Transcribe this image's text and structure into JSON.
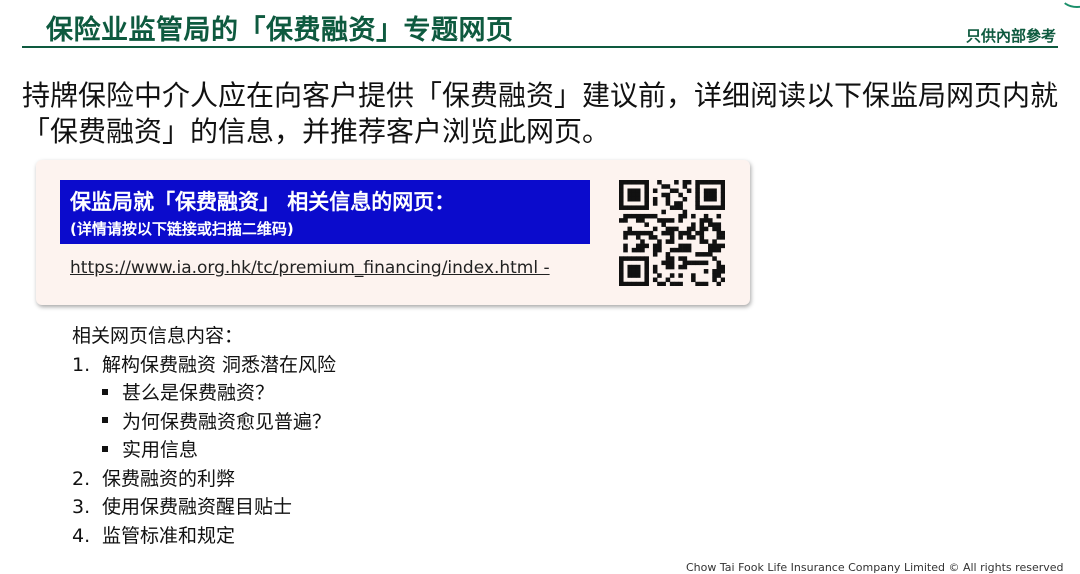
{
  "header": {
    "title": "保险业监管局的「保费融资」专题网页",
    "internal_note": "只供內部參考"
  },
  "intro": {
    "text": "持牌保险中介人应在向客户提供「保费融资」建议前，详细阅读以下保监局网页内就「保费融资」的信息，并推荐客户浏览此网页。"
  },
  "info_box": {
    "banner_title": "保监局就「保费融资」 相关信息的网页：",
    "banner_subtitle": "(详情请按以下链接或扫描二维码)",
    "url": "https://www.ia.org.hk/tc/premium_financing/index.html -"
  },
  "contents": {
    "heading": "相关网页信息内容：",
    "items": [
      {
        "number": "1.",
        "label": "解构保费融资 洞悉潜在风险",
        "sub_items": [
          "甚么是保费融资？",
          "为何保费融资愈见普遍？",
          "实用信息"
        ]
      },
      {
        "number": "2.",
        "label": "保费融资的利弊"
      },
      {
        "number": "3.",
        "label": "使用保费融资醒目贴士"
      },
      {
        "number": "4.",
        "label": "监管标准和规定"
      }
    ]
  },
  "footer": {
    "text": "Chow Tai Fook Life Insurance Company Limited © All rights reserved"
  },
  "colors": {
    "title_green": "#0e5a3f",
    "banner_blue": "#0b0bcc",
    "box_background": "#fdf3ef"
  }
}
